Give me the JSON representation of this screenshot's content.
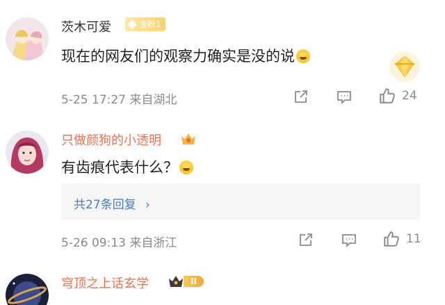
{
  "comments": [
    {
      "username": "茨木可爱",
      "badge": "金粉1",
      "text": "现在的网友们的观察力确实是没的说",
      "emoji": "laugh-cry",
      "meta": "5-25 17:27 来自湖北",
      "likes": "24"
    },
    {
      "username": "只做颜狗的小透明",
      "text": "有齿痕代表什么？",
      "emoji": "laugh",
      "reply_summary": "共27条回复",
      "meta": "5-26 09:13 来自浙江",
      "likes": "11"
    },
    {
      "username": "穹顶之上话玄学",
      "level_badge": "II"
    }
  ],
  "colors": {
    "vip_name": "#eb7350",
    "link": "#4a7fb5",
    "meta": "#8a8a8a",
    "badge_gold": "#fbd36a"
  }
}
